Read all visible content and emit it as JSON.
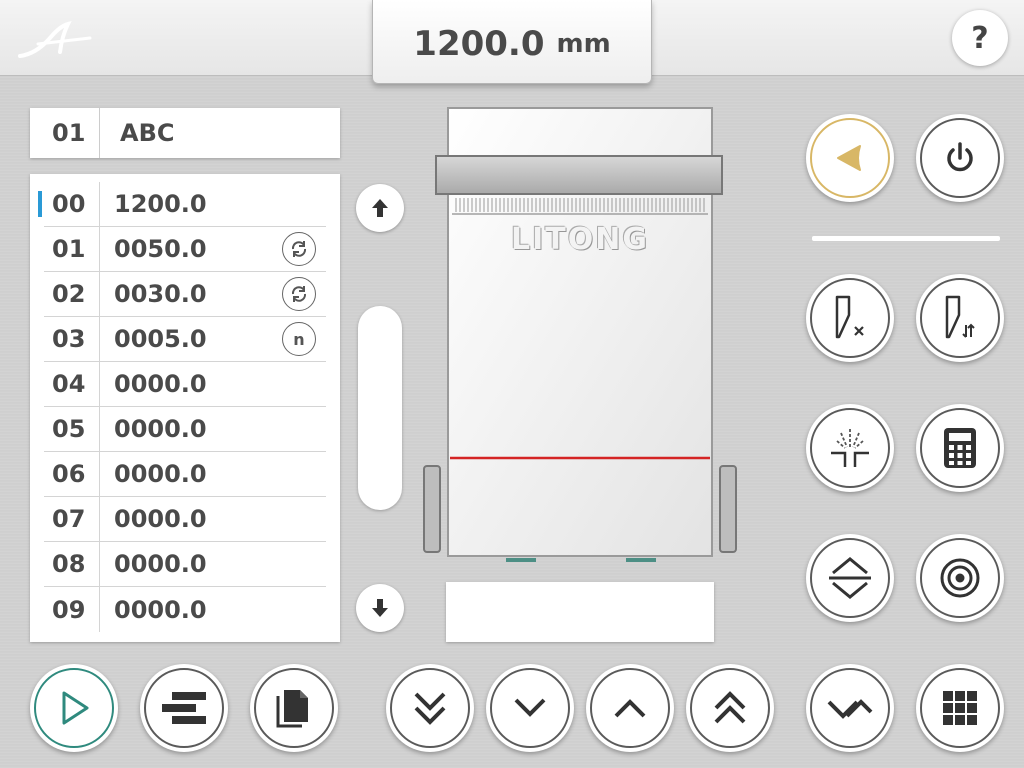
{
  "header": {
    "measurement_value": "1200.0",
    "measurement_unit": "mm",
    "help_label": "?"
  },
  "program": {
    "number": "01",
    "name": "ABC"
  },
  "steps": [
    {
      "index": "00",
      "value": "1200.0",
      "icon": ""
    },
    {
      "index": "01",
      "value": "0050.0",
      "icon": "repeat-icon"
    },
    {
      "index": "02",
      "value": "0030.0",
      "icon": "repeat-icon"
    },
    {
      "index": "03",
      "value": "0005.0",
      "icon": "n-icon"
    },
    {
      "index": "04",
      "value": "0000.0",
      "icon": ""
    },
    {
      "index": "05",
      "value": "0000.0",
      "icon": ""
    },
    {
      "index": "06",
      "value": "0000.0",
      "icon": ""
    },
    {
      "index": "07",
      "value": "0000.0",
      "icon": ""
    },
    {
      "index": "08",
      "value": "0000.0",
      "icon": ""
    },
    {
      "index": "09",
      "value": "0000.0",
      "icon": ""
    }
  ],
  "machine": {
    "brand": "LITONG"
  },
  "colors": {
    "accent": "#2a9ad6",
    "gold": "#d8b766",
    "teal": "#2f8a7e",
    "cut_line": "#d42424"
  }
}
